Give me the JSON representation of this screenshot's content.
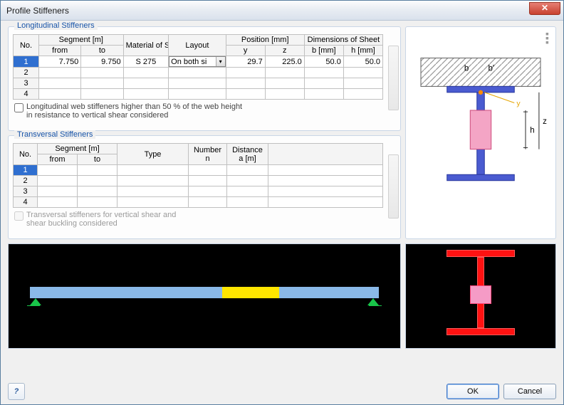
{
  "window": {
    "title": "Profile Stiffeners"
  },
  "longitudinal": {
    "legend": "Longitudinal Stiffeners",
    "headers": {
      "no": "No.",
      "segment": "Segment [m]",
      "from": "from",
      "to": "to",
      "material": "Material of Steel",
      "layout": "Layout",
      "position": "Position [mm]",
      "y": "y",
      "z": "z",
      "dims": "Dimensions of Sheet",
      "b": "b [mm]",
      "h": "h [mm]"
    },
    "rows": [
      {
        "no": "1",
        "from": "7.750",
        "to": "9.750",
        "steel": "S 275",
        "layout": "On both si",
        "y": "29.7",
        "z": "225.0",
        "b": "50.0",
        "h": "50.0"
      },
      {
        "no": "2",
        "from": "",
        "to": "",
        "steel": "",
        "layout": "",
        "y": "",
        "z": "",
        "b": "",
        "h": ""
      },
      {
        "no": "3",
        "from": "",
        "to": "",
        "steel": "",
        "layout": "",
        "y": "",
        "z": "",
        "b": "",
        "h": ""
      },
      {
        "no": "4",
        "from": "",
        "to": "",
        "steel": "",
        "layout": "",
        "y": "",
        "z": "",
        "b": "",
        "h": ""
      }
    ],
    "checkbox_label": "Longitudinal web stiffeners higher than 50 % of the web height\nin resistance to vertical shear considered"
  },
  "transversal": {
    "legend": "Transversal Stiffeners",
    "headers": {
      "no": "No.",
      "segment": "Segment [m]",
      "from": "from",
      "to": "to",
      "type": "Type",
      "number": "Number n",
      "distance": "Distance a [m]"
    },
    "rows": [
      {
        "no": "1"
      },
      {
        "no": "2"
      },
      {
        "no": "3"
      },
      {
        "no": "4"
      }
    ],
    "checkbox_label": "Transversal stiffeners for vertical shear and\nshear buckling considered"
  },
  "diagram_labels": {
    "b1": "b",
    "b2": "b'",
    "h": "h",
    "y": "y",
    "z": "z"
  },
  "buttons": {
    "help": "?",
    "ok": "OK",
    "cancel": "Cancel"
  },
  "close_glyph": "✕"
}
